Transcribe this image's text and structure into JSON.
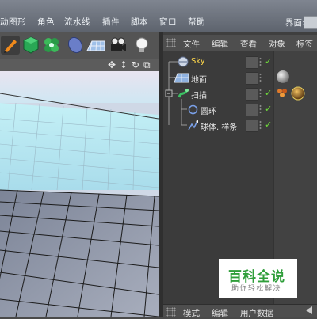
{
  "menubar": {
    "items": [
      "动图形",
      "角色",
      "流水线",
      "插件",
      "脚本",
      "窗口",
      "帮助"
    ],
    "layout_label": "界面:"
  },
  "toolbar": {
    "icons": [
      "pen-tool-icon",
      "cube-primitive-icon",
      "subdivision-icon",
      "deformer-icon",
      "floor-grid-icon",
      "camera-icon",
      "light-bulb-icon"
    ]
  },
  "viewport": {
    "nav_icons": [
      "move-view-icon",
      "pan-view-icon",
      "rotate-view-icon",
      "maximize-view-icon"
    ]
  },
  "object_manager": {
    "menu": [
      "文件",
      "编辑",
      "查看",
      "对象",
      "标签"
    ],
    "objects": [
      {
        "name": "Sky",
        "icon": "sky-icon",
        "selected": true,
        "check": "✓"
      },
      {
        "name": "地面",
        "icon": "floor-icon",
        "selected": false,
        "check": ""
      },
      {
        "name": "扫描",
        "icon": "sweep-icon",
        "selected": false,
        "check": "✓"
      },
      {
        "name": "圆环",
        "icon": "circle-spline-icon",
        "selected": false,
        "check": "✓"
      },
      {
        "name": "球体. 样条",
        "icon": "spline-icon",
        "selected": false,
        "check": "✓"
      }
    ]
  },
  "attributes": {
    "menu": [
      "模式",
      "编辑",
      "用户数据"
    ]
  },
  "watermark": {
    "title": "百科全说",
    "subtitle": "助你轻松解决"
  },
  "colors": {
    "selected_label": "#ffd84a",
    "check": "#6fdc3a",
    "watermark_green": "#2f9e3a"
  }
}
